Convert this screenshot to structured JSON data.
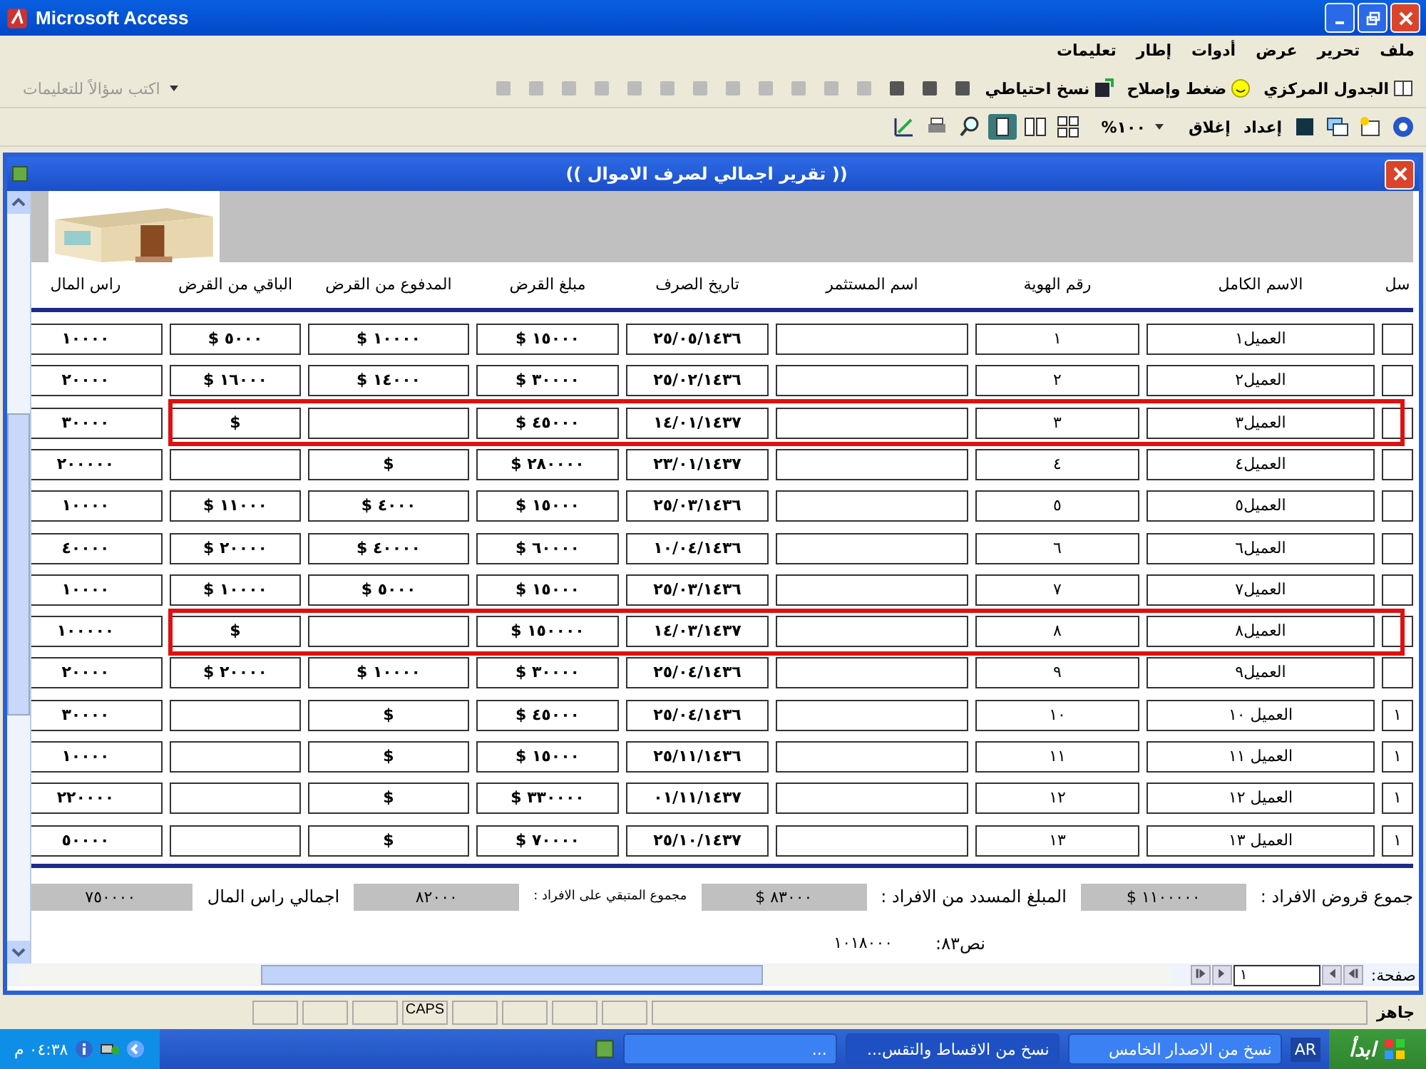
{
  "app_window": {
    "title": "Microsoft Access"
  },
  "menu": [
    "ملف",
    "تحرير",
    "عرض",
    "أدوات",
    "إطار",
    "تعليمات"
  ],
  "toolbar": {
    "buttons": [
      "الجدول المركزي",
      "ضغط وإصلاح",
      "نسخ احتياطي"
    ],
    "help_placeholder": "اكتب سؤالاً للتعليمات"
  },
  "print_toolbar": {
    "zoom": "١٠٠%",
    "buttons": [
      "إعداد",
      "إغلاق"
    ]
  },
  "report": {
    "title": "(( تقرير اجمالي لصرف الاموال ))",
    "columns": [
      "سل",
      "الاسم الكامل",
      "رقم الهوية",
      "اسم المستثمر",
      "تاريخ الصرف",
      "مبلغ القرض",
      "المدفوع من القرض",
      "الباقي من القرض",
      "راس المال"
    ],
    "rows": [
      {
        "highlighted": false,
        "cells": [
          "",
          "العميل١",
          "١",
          "",
          "٢٥/٠٥/١٤٣٦",
          "$ ١٥٠٠٠",
          "$ ١٠٠٠٠",
          "$ ٥٠٠٠",
          "١٠٠٠٠"
        ]
      },
      {
        "highlighted": false,
        "cells": [
          "",
          "العميل٢",
          "٢",
          "",
          "٢٥/٠٢/١٤٣٦",
          "$ ٣٠٠٠٠",
          "$ ١٤٠٠٠",
          "$ ١٦٠٠٠",
          "٢٠٠٠٠"
        ]
      },
      {
        "highlighted": true,
        "cells": [
          "",
          "العميل٣",
          "٣",
          "",
          "١٤/٠١/١٤٣٧",
          "$ ٤٥٠٠٠",
          "",
          "$",
          "٣٠٠٠٠"
        ]
      },
      {
        "highlighted": false,
        "cells": [
          "",
          "العميل٤",
          "٤",
          "",
          "٢٣/٠١/١٤٣٧",
          "$ ٢٨٠٠٠٠",
          "$",
          "",
          "٢٠٠٠٠٠"
        ]
      },
      {
        "highlighted": false,
        "cells": [
          "",
          "العميل٥",
          "٥",
          "",
          "٢٥/٠٣/١٤٣٦",
          "$ ١٥٠٠٠",
          "$ ٤٠٠٠",
          "$ ١١٠٠٠",
          "١٠٠٠٠"
        ]
      },
      {
        "highlighted": false,
        "cells": [
          "",
          "العميل٦",
          "٦",
          "",
          "١٠/٠٤/١٤٣٦",
          "$ ٦٠٠٠٠",
          "$ ٤٠٠٠٠",
          "$ ٢٠٠٠٠",
          "٤٠٠٠٠"
        ]
      },
      {
        "highlighted": false,
        "cells": [
          "",
          "العميل٧",
          "٧",
          "",
          "٢٥/٠٣/١٤٣٦",
          "$ ١٥٠٠٠",
          "$ ٥٠٠٠",
          "$ ١٠٠٠٠",
          "١٠٠٠٠"
        ]
      },
      {
        "highlighted": true,
        "cells": [
          "",
          "العميل٨",
          "٨",
          "",
          "١٤/٠٣/١٤٣٧",
          "$ ١٥٠٠٠٠",
          "",
          "$",
          "١٠٠٠٠٠"
        ]
      },
      {
        "highlighted": false,
        "cells": [
          "",
          "العميل٩",
          "٩",
          "",
          "٢٥/٠٤/١٤٣٦",
          "$ ٣٠٠٠٠",
          "$ ١٠٠٠٠",
          "$ ٢٠٠٠٠",
          "٢٠٠٠٠"
        ]
      },
      {
        "highlighted": false,
        "cells": [
          "١",
          "العميل ١٠",
          "١٠",
          "",
          "٢٥/٠٤/١٤٣٦",
          "$ ٤٥٠٠٠",
          "$",
          "",
          "٣٠٠٠٠"
        ]
      },
      {
        "highlighted": false,
        "cells": [
          "١",
          "العميل ١١",
          "١١",
          "",
          "٢٥/١١/١٤٣٦",
          "$ ١٥٠٠٠",
          "$",
          "",
          "١٠٠٠٠"
        ]
      },
      {
        "highlighted": false,
        "cells": [
          "١",
          "العميل ١٢",
          "١٢",
          "",
          "٠١/١١/١٤٣٧",
          "$ ٣٣٠٠٠٠",
          "$",
          "",
          "٢٢٠٠٠٠"
        ]
      },
      {
        "highlighted": false,
        "cells": [
          "١",
          "العميل ١٣",
          "١٣",
          "",
          "٢٥/١٠/١٤٣٧",
          "$ ٧٠٠٠٠",
          "$",
          "",
          "٥٠٠٠٠"
        ]
      }
    ],
    "totals": [
      {
        "label": "جموع قروض الافراد :",
        "value": "$ ١١٠٠٠٠٠"
      },
      {
        "label": "المبلغ المسدد من الافراد :",
        "value": "$ ٨٣٠٠٠"
      },
      {
        "label": "مجموع المتبقي على الافراد :",
        "value": "٨٢٠٠٠"
      },
      {
        "label": "اجمالي راس المال",
        "value": "٧٥٠٠٠٠"
      }
    ],
    "text_field": {
      "label": "نص٨٣:",
      "value": "١٠١٨٠٠٠"
    },
    "page": {
      "label": "صفحة:",
      "value": "١"
    }
  },
  "status_bar": {
    "text": "جاهز",
    "indicators": [
      "CAPS"
    ]
  },
  "taskbar": {
    "start": "ابدأ",
    "language": "AR",
    "tasks": [
      "نسخ من الاصدار الخامس",
      "نسخ من الاقساط والتقس...",
      "..."
    ],
    "clock": "٠٤:٣٨ م"
  }
}
